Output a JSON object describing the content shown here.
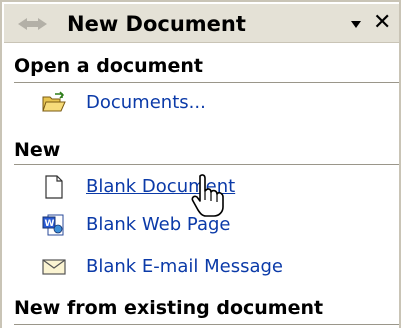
{
  "header": {
    "title": "New Document",
    "icons": [
      "back-arrow-icon",
      "forward-arrow-icon",
      "dropdown-arrow-icon",
      "close-icon"
    ]
  },
  "sections": {
    "open": {
      "heading": "Open a document",
      "items": [
        {
          "label": "Documents...",
          "icon": "open-folder-icon"
        }
      ]
    },
    "new": {
      "heading": "New",
      "items": [
        {
          "label": "Blank Document",
          "icon": "blank-page-icon"
        },
        {
          "label": "Blank Web Page",
          "icon": "web-page-icon"
        },
        {
          "label": "Blank E-mail Message",
          "icon": "envelope-icon"
        }
      ]
    },
    "existing": {
      "heading": "New from existing document"
    }
  },
  "colors": {
    "link": "#0b3aa8",
    "titlebar": "#e4e1d6",
    "divider": "#9a968a"
  }
}
